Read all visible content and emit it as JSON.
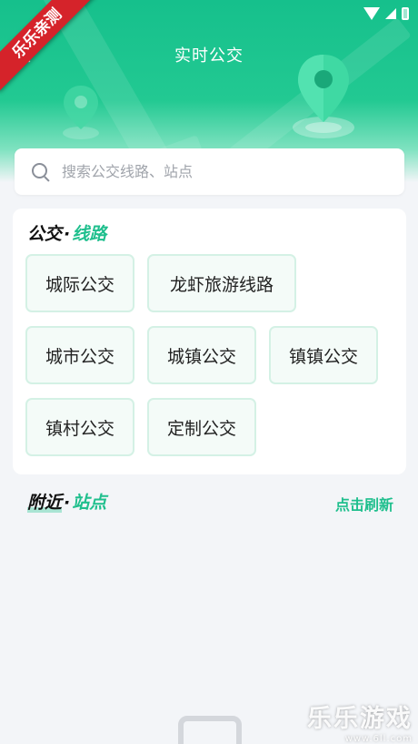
{
  "header": {
    "title": "实时公交"
  },
  "ribbon": "乐乐亲测",
  "search": {
    "placeholder": "搜索公交线路、站点"
  },
  "routes": {
    "title_main": "公交",
    "title_dot": "·",
    "title_accent": "线路",
    "categories": [
      "城际公交",
      "龙虾旅游线路",
      "城市公交",
      "城镇公交",
      "镇镇公交",
      "镇村公交",
      "定制公交"
    ]
  },
  "nearby": {
    "title_main": "附近",
    "title_dot": "·",
    "title_accent": "站点",
    "refresh_label": "点击刷新"
  },
  "watermark": {
    "brand": "乐乐游戏",
    "url": "www.6ll.com"
  },
  "colors": {
    "accent": "#1fbf8d",
    "header": "#16c08c",
    "ribbon": "#d5232a"
  }
}
